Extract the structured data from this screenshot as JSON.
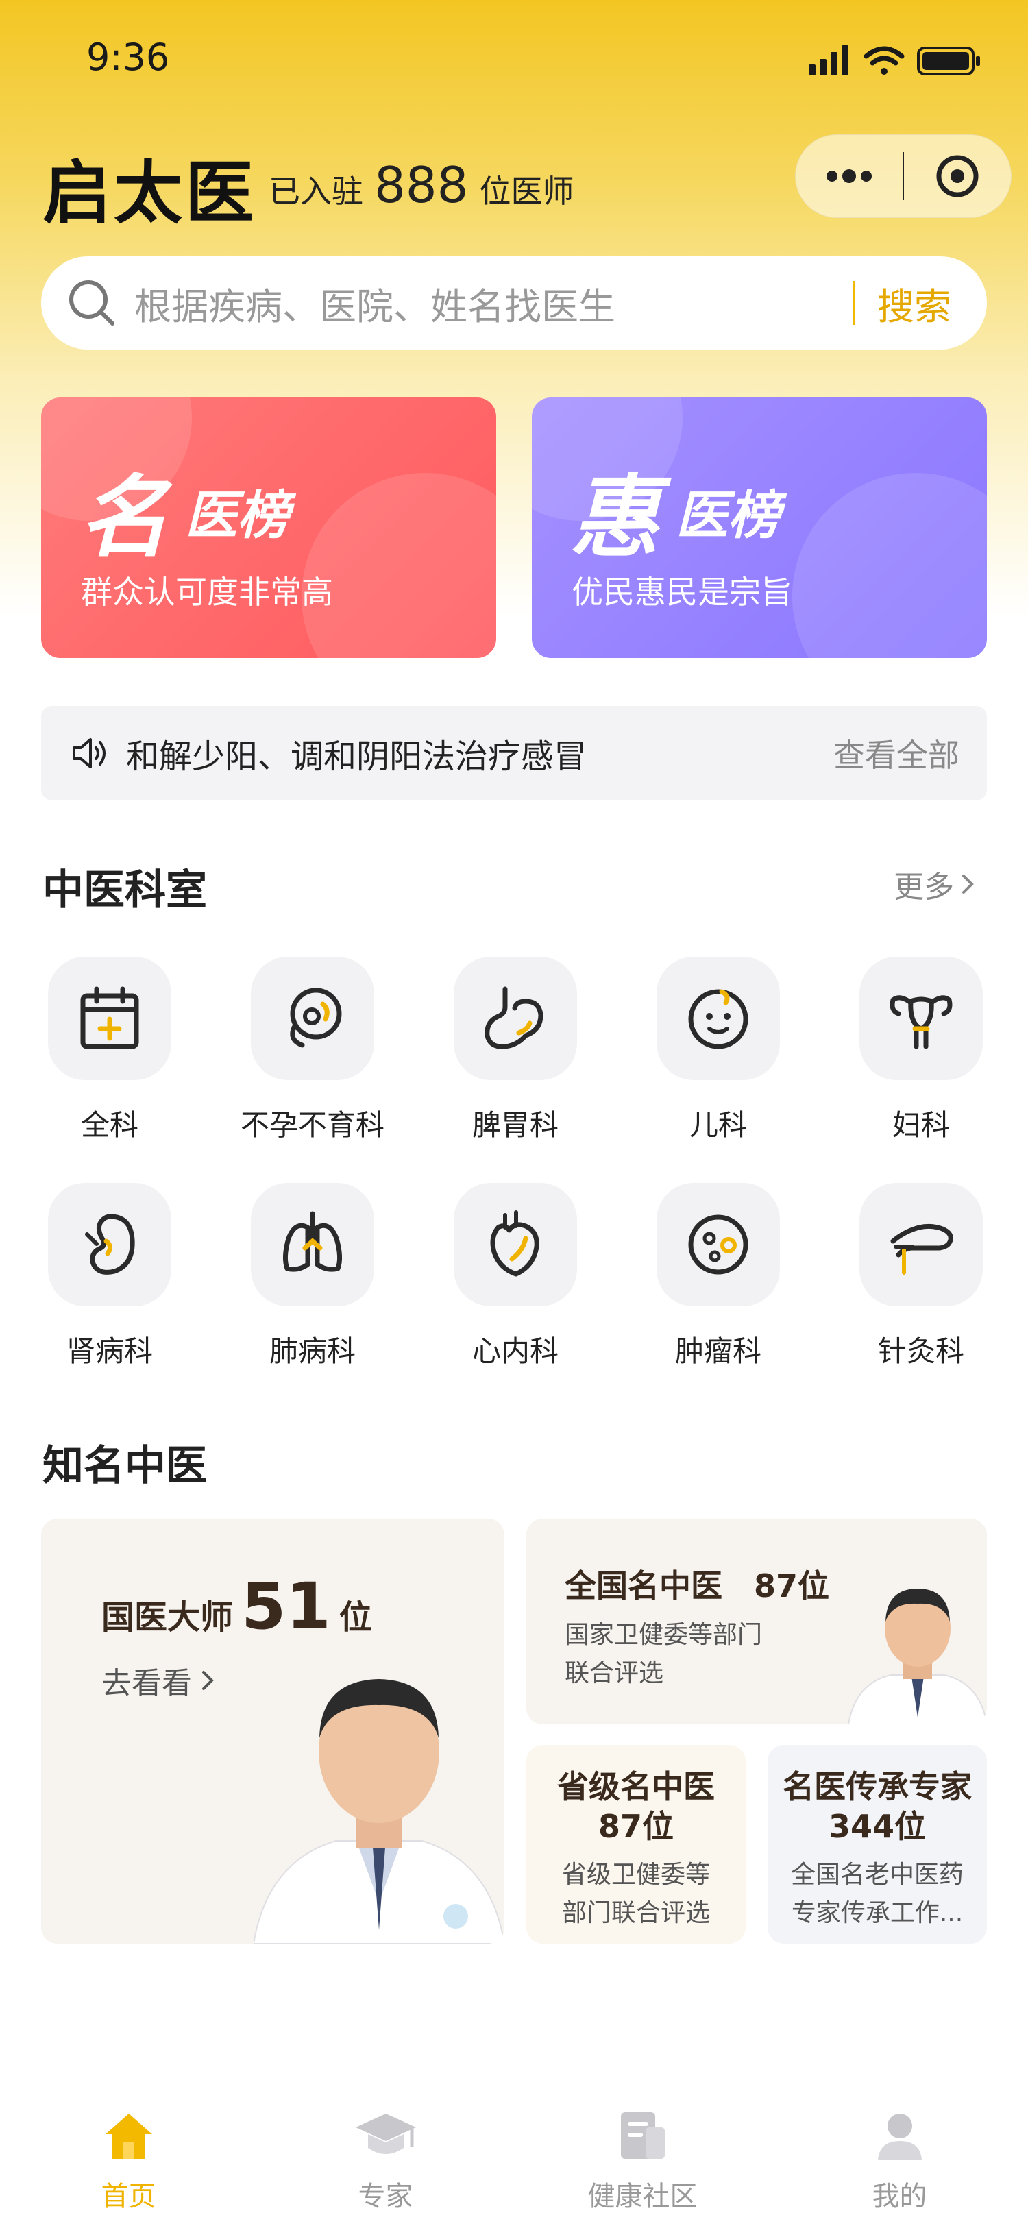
{
  "status_bar": {
    "time": "9:36"
  },
  "header": {
    "title": "启太医",
    "joined_prefix": "已入驻",
    "doctor_count": "888",
    "joined_suffix": "位医师"
  },
  "search": {
    "placeholder": "根据疾病、医院、姓名找医生",
    "button": "搜索"
  },
  "rank_cards": [
    {
      "big": "名",
      "sub": "医榜",
      "desc": "群众认可度非常高",
      "color": "#ff5e62"
    },
    {
      "big": "惠",
      "sub": "医榜",
      "desc": "优民惠民是宗旨",
      "color": "#8b7bff"
    }
  ],
  "notice": {
    "text": "和解少阳、调和阴阳法治疗感冒",
    "view_all": "查看全部"
  },
  "departments_section": {
    "title": "中医科室",
    "more": "更多"
  },
  "departments": [
    {
      "label": "全科",
      "icon": "calendar-plus-icon"
    },
    {
      "label": "不孕不育科",
      "icon": "fetus-icon"
    },
    {
      "label": "脾胃科",
      "icon": "stomach-icon"
    },
    {
      "label": "儿科",
      "icon": "baby-face-icon"
    },
    {
      "label": "妇科",
      "icon": "uterus-icon"
    },
    {
      "label": "肾病科",
      "icon": "kidney-icon"
    },
    {
      "label": "肺病科",
      "icon": "lungs-icon"
    },
    {
      "label": "心内科",
      "icon": "heart-icon"
    },
    {
      "label": "肿瘤科",
      "icon": "tumor-cell-icon"
    },
    {
      "label": "针灸科",
      "icon": "acupuncture-icon"
    }
  ],
  "famous_section": {
    "title": "知名中医"
  },
  "famous": {
    "master": {
      "title": "国医大师",
      "count": "51",
      "unit": "位",
      "link": "去看看"
    },
    "national": {
      "title": "全国名中医　87位",
      "desc1": "国家卫健委等部门",
      "desc2": "联合评选"
    },
    "provincial": {
      "title": "省级名中医",
      "count": "87位",
      "desc1": "省级卫健委等",
      "desc2": "部门联合评选"
    },
    "inheritance": {
      "title": "名医传承专家",
      "count": "344位",
      "desc1": "全国名老中医药",
      "desc2": "专家传承工作..."
    }
  },
  "tabbar": [
    {
      "label": "首页",
      "icon": "home-icon",
      "active": true
    },
    {
      "label": "专家",
      "icon": "graduation-cap-icon",
      "active": false
    },
    {
      "label": "健康社区",
      "icon": "document-icon",
      "active": false
    },
    {
      "label": "我的",
      "icon": "user-icon",
      "active": false
    }
  ],
  "colors": {
    "accent": "#f0b400",
    "brand_yellow": "#f3c623",
    "text_dark": "#222222"
  }
}
